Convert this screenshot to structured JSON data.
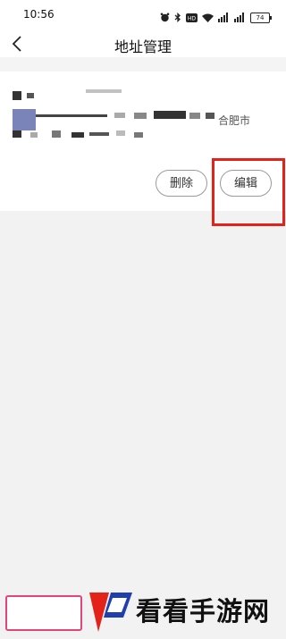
{
  "status_bar": {
    "time": "10:56",
    "battery_level": "74",
    "icons": [
      "alarm-icon",
      "bluetooth-icon",
      "hd-icon",
      "wifi-icon",
      "signal-icon",
      "signal-icon",
      "battery-icon"
    ]
  },
  "header": {
    "title": "地址管理",
    "back_icon": "chevron-left-icon"
  },
  "address_card": {
    "name_row": "",
    "address_tail": "合肥市",
    "delete_label": "删除",
    "edit_label": "编辑"
  },
  "annotation": {
    "highlight_color": "#e3231a",
    "target": "edit-button"
  },
  "watermark": {
    "text": "看看手游网"
  }
}
